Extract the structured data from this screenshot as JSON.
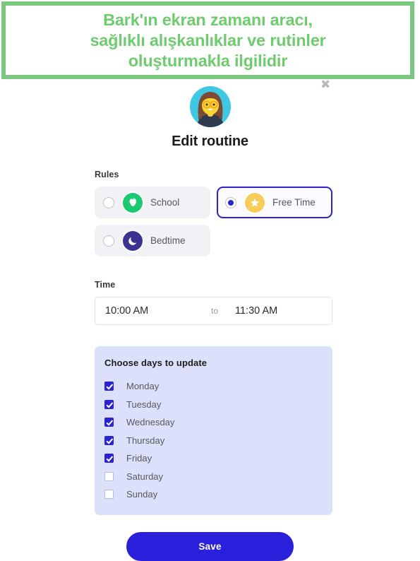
{
  "banner": {
    "text": "Bark'ın ekran zamanı aracı,\nsağlıklı alışkanlıklar ve rutinler\noluşturmakla ilgilidir",
    "border_color": "#7ac77f",
    "text_color": "#6fcb6f"
  },
  "cursor_artifact": "✖",
  "header": {
    "avatar_alt": "user-avatar",
    "title": "Edit routine"
  },
  "rules": {
    "label": "Rules",
    "options": [
      {
        "id": "school",
        "label": "School",
        "icon": "apple-icon",
        "icon_color": "#19ca72",
        "selected": false
      },
      {
        "id": "freetime",
        "label": "Free Time",
        "icon": "star-icon",
        "icon_color": "#f6cd5b",
        "selected": true
      },
      {
        "id": "bedtime",
        "label": "Bedtime",
        "icon": "moon-icon",
        "icon_color": "#3b3390",
        "selected": false
      }
    ]
  },
  "time": {
    "label": "Time",
    "start": "10:00 AM",
    "separator": "to",
    "end": "11:30 AM"
  },
  "days": {
    "title": "Choose days to update",
    "items": [
      {
        "label": "Monday",
        "checked": true
      },
      {
        "label": "Tuesday",
        "checked": true
      },
      {
        "label": "Wednesday",
        "checked": true
      },
      {
        "label": "Thursday",
        "checked": true
      },
      {
        "label": "Friday",
        "checked": true
      },
      {
        "label": "Saturday",
        "checked": false
      },
      {
        "label": "Sunday",
        "checked": false
      }
    ]
  },
  "footer": {
    "save_label": "Save",
    "accent_color": "#2a20dc"
  }
}
